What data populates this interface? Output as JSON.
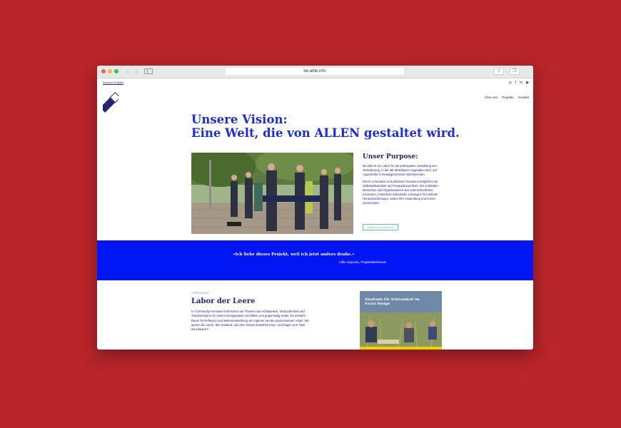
{
  "browser": {
    "url": "be-able.info"
  },
  "site": {
    "language_switch": "Deutsch English",
    "social_icons": [
      "instagram-icon",
      "facebook-icon",
      "linkedin-icon",
      "youtube-icon"
    ],
    "social_glyphs": [
      "◎",
      "f",
      "in",
      "▶"
    ],
    "nav": [
      "Über uns",
      "Projekte",
      "Kontakt"
    ]
  },
  "hero": {
    "line1": "Unsere Vision:",
    "line2": "Eine Welt, die von ALLEN gestaltet wird."
  },
  "purpose": {
    "title": "Unser Purpose:",
    "paragraph1": "Be able ist ein Labor für die partizipative Gestaltung von Veränderung, in der alle Beteiligten eingeladen sind, auf Augenhöhe in Designprozessen mitzuforschen.",
    "paragraph2": "Durch co-kreative und inklusive Formate ermöglichen wir Selbstwirksamkeit und Perspektivwechsel. Wir verbinden Menschen und Organisationen aus unterschiedlichen Kontexten, entwickeln individuelle Lösungen für konkrete Herausforderungen, testen ihre Anwendung und lernen voneinander.",
    "button": "Erfahre mehr Über uns"
  },
  "quote": {
    "text": "»Ich liebe dieses Projekt, weil ich jetzt anders denke.«",
    "author": "Adile Karpuzku, Projektteilnehmerin"
  },
  "project": {
    "category": "Achtsamkeit",
    "title": "Labor der Leere",
    "text": "In Community-Formaten beforschen wir Themen wie Achtsamkeit, Verbundenheit und Transformation für unsere Designpraxis und bilden uns gegenseitig weiter. Es entsteht Raum für Reflexion und Weiterentwicklung der eigenen wie der gemeinsamen Arbeit. Wir spüren die Leere, den Zustand, aus dem Neues entstehen kann, und fragen uns: Was wird daraus?",
    "card_title": "Akademie für Achtsamkeit im Social Design"
  },
  "colors": {
    "background": "#b8252a",
    "brand_blue": "#1c2bdc",
    "navy": "#22247a",
    "accent_green": "#5fc79a",
    "quote_band": "#0016f5"
  }
}
